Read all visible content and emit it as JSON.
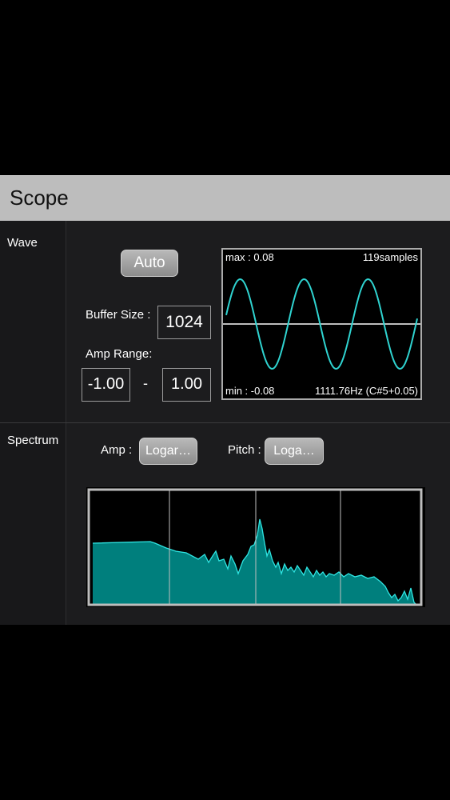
{
  "header": {
    "title": "Scope"
  },
  "wave": {
    "section_label": "Wave",
    "auto_label": "Auto",
    "buffer_size_label": "Buffer Size :",
    "buffer_size_value": "1024",
    "amp_range_label": "Amp Range:",
    "amp_min": "-1.00",
    "amp_separator": "-",
    "amp_max": "1.00",
    "scope": {
      "max_text": "max : 0.08",
      "samples_text": "119samples",
      "min_text": "min : -0.08",
      "freq_text": "1111.76Hz (C#5+0.05)",
      "wave_color": "#2fd3d0"
    }
  },
  "spectrum": {
    "section_label": "Spectrum",
    "amp_label": "Amp :",
    "amp_value": "Logar…",
    "pitch_label": "Pitch :",
    "pitch_value": "Loga…",
    "fill_color": "#007f7d",
    "line_color": "#2fe6e3"
  }
}
